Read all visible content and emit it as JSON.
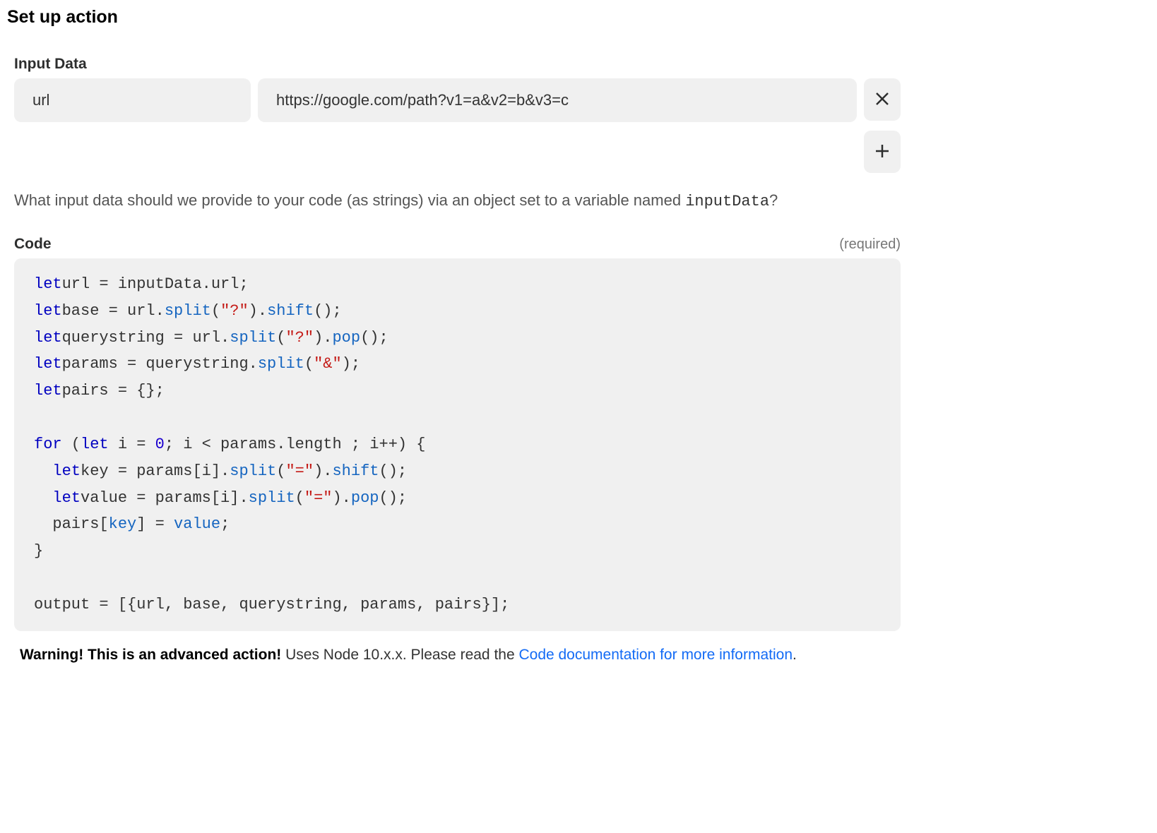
{
  "title": "Set up action",
  "inputData": {
    "label": "Input Data",
    "rows": [
      {
        "key": "url",
        "value": "https://google.com/path?v1=a&v2=b&v3=c"
      }
    ]
  },
  "helper": {
    "prefix": "What input data should we provide to your code (as strings) via an object set to a variable named ",
    "varname": "inputData",
    "suffix": "?"
  },
  "code": {
    "label": "Code",
    "required": "(required)",
    "tokens": [
      [
        [
          "kw",
          "let"
        ],
        [
          "",
          ""
        ],
        [
          "",
          "url"
        ],
        [
          "",
          " = "
        ],
        [
          "",
          "inputData.url;"
        ]
      ],
      [
        [
          "kw",
          "let"
        ],
        [
          "",
          ""
        ],
        [
          "",
          "base"
        ],
        [
          "",
          " = "
        ],
        [
          "",
          "url."
        ],
        [
          "var",
          "split"
        ],
        [
          "",
          "("
        ],
        [
          "str",
          "\"?\""
        ],
        [
          "",
          ")."
        ],
        [
          "var",
          "shift"
        ],
        [
          "",
          "();"
        ]
      ],
      [
        [
          "kw",
          "let"
        ],
        [
          "",
          ""
        ],
        [
          "",
          "querystring"
        ],
        [
          "",
          " = "
        ],
        [
          "",
          "url."
        ],
        [
          "var",
          "split"
        ],
        [
          "",
          "("
        ],
        [
          "str",
          "\"?\""
        ],
        [
          "",
          ")."
        ],
        [
          "var",
          "pop"
        ],
        [
          "",
          "();"
        ]
      ],
      [
        [
          "kw",
          "let"
        ],
        [
          "",
          ""
        ],
        [
          "",
          "params"
        ],
        [
          "",
          " = "
        ],
        [
          "",
          "querystring."
        ],
        [
          "var",
          "split"
        ],
        [
          "",
          "("
        ],
        [
          "str",
          "\"&\""
        ],
        [
          "",
          ");"
        ]
      ],
      [
        [
          "kw",
          "let"
        ],
        [
          "",
          ""
        ],
        [
          "",
          "pairs"
        ],
        [
          "",
          " = {};"
        ]
      ],
      [],
      [
        [
          "kw",
          "for"
        ],
        [
          "",
          " ("
        ],
        [
          "kw",
          "let"
        ],
        [
          "",
          " i = "
        ],
        [
          "num",
          "0"
        ],
        [
          "",
          "; i < params.length ; i++) {"
        ]
      ],
      [
        [
          "",
          "  "
        ],
        [
          "kw",
          "let"
        ],
        [
          "",
          ""
        ],
        [
          "",
          "key"
        ],
        [
          "",
          " = "
        ],
        [
          "",
          "params[i]."
        ],
        [
          "var",
          "split"
        ],
        [
          "",
          "("
        ],
        [
          "str",
          "\"=\""
        ],
        [
          "",
          ")."
        ],
        [
          "var",
          "shift"
        ],
        [
          "",
          "();"
        ]
      ],
      [
        [
          "",
          "  "
        ],
        [
          "kw",
          "let"
        ],
        [
          "",
          ""
        ],
        [
          "",
          "value"
        ],
        [
          "",
          " = "
        ],
        [
          "",
          "params[i]."
        ],
        [
          "var",
          "split"
        ],
        [
          "",
          "("
        ],
        [
          "str",
          "\"=\""
        ],
        [
          "",
          ")."
        ],
        [
          "var",
          "pop"
        ],
        [
          "",
          "();"
        ]
      ],
      [
        [
          "",
          "  pairs["
        ],
        [
          "var",
          "key"
        ],
        [
          "",
          "] = "
        ],
        [
          "var",
          "value"
        ],
        [
          "",
          ";"
        ]
      ],
      [
        [
          "",
          "}"
        ]
      ],
      [],
      [
        [
          "",
          "output = [{url, base, querystring, params, pairs}];"
        ]
      ]
    ]
  },
  "warning": {
    "strong": "Warning! This is an advanced action!",
    "text": " Uses Node 10.x.x. Please read the ",
    "link": "Code documentation for more information",
    "tail": "."
  }
}
